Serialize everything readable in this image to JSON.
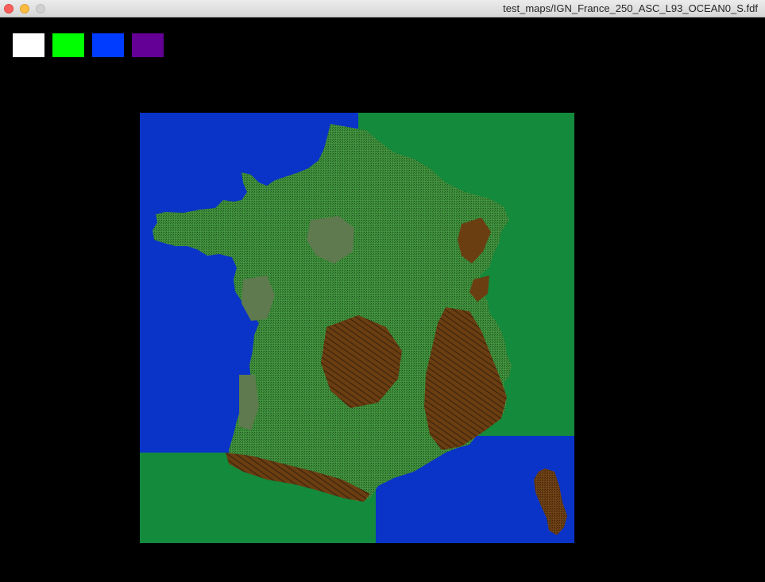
{
  "window": {
    "title": "test_maps/IGN_France_250_ASC_L93_OCEAN0_S.fdf"
  },
  "palette": {
    "swatches": [
      {
        "name": "white",
        "color": "#ffffff"
      },
      {
        "name": "green",
        "color": "#00ff00"
      },
      {
        "name": "blue",
        "color": "#003cff"
      },
      {
        "name": "purple",
        "color": "#640096"
      }
    ]
  },
  "map": {
    "colors": {
      "ocean": "#0a33c8",
      "land_low": "#3d8f3a",
      "land_mid": "#5e7a4e",
      "highland": "#6b3e12",
      "background_green": "#138a3c"
    }
  }
}
